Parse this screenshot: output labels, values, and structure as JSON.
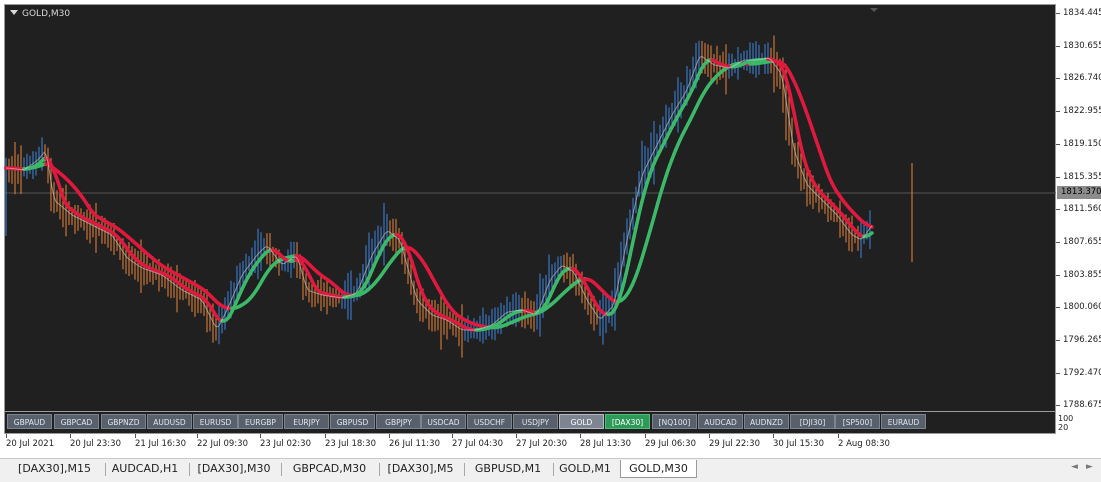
{
  "chart": {
    "symbol_label": "GOLD,M30",
    "current_price": "1813.370",
    "price_ticks": [
      "1834.445",
      "1830.655",
      "1826.740",
      "1822.955",
      "1819.150",
      "1815.355",
      "1811.560",
      "1807.655",
      "1803.855",
      "1800.060",
      "1796.265",
      "1792.470",
      "1788.675"
    ],
    "indicator_scale": [
      "100",
      "20"
    ],
    "time_ticks": [
      "20 Jul 2021",
      "20 Jul 23:30",
      "21 Jul 16:30",
      "22 Jul 09:30",
      "23 Jul 02:30",
      "23 Jul 18:30",
      "26 Jul 11:30",
      "27 Jul 04:30",
      "27 Jul 20:30",
      "28 Jul 13:30",
      "29 Jul 06:30",
      "29 Jul 22:30",
      "30 Jul 15:30",
      "2 Aug 08:30"
    ],
    "colors": {
      "background": "#202020",
      "bull_bar": "#3b86e0",
      "bear_bar": "#e8833a",
      "ma_up": "#3cb968",
      "ma_down": "#e0193f",
      "price_line": "#d9d9d9",
      "grid": "#555555"
    }
  },
  "symbol_buttons": [
    {
      "label": "GBPAUD"
    },
    {
      "label": "GBPCAD"
    },
    {
      "label": "GBPNZD"
    },
    {
      "label": "AUDUSD"
    },
    {
      "label": "EURUSD"
    },
    {
      "label": "EURGBP"
    },
    {
      "label": "EURJPY"
    },
    {
      "label": "GBPUSD"
    },
    {
      "label": "GBPJPY"
    },
    {
      "label": "USDCAD"
    },
    {
      "label": "USDCHF"
    },
    {
      "label": "USDJPY"
    },
    {
      "label": "GOLD",
      "state": "active"
    },
    {
      "label": "[DAX30]",
      "state": "highlight"
    },
    {
      "label": "[NQ100]"
    },
    {
      "label": "AUDCAD"
    },
    {
      "label": "AUDNZD"
    },
    {
      "label": "[DJI30]"
    },
    {
      "label": "[SP500]"
    },
    {
      "label": "EURAUD"
    }
  ],
  "tabs": [
    {
      "label": "[DAX30],M15"
    },
    {
      "label": "AUDCAD,H1"
    },
    {
      "label": "[DAX30],M30"
    },
    {
      "label": "GBPCAD,M30"
    },
    {
      "label": "[DAX30],M5"
    },
    {
      "label": "GBPUSD,M1"
    },
    {
      "label": "GOLD,M1"
    },
    {
      "label": "GOLD,M30",
      "active": true
    }
  ],
  "tab_nav": {
    "left": "◄",
    "right": "►"
  }
}
